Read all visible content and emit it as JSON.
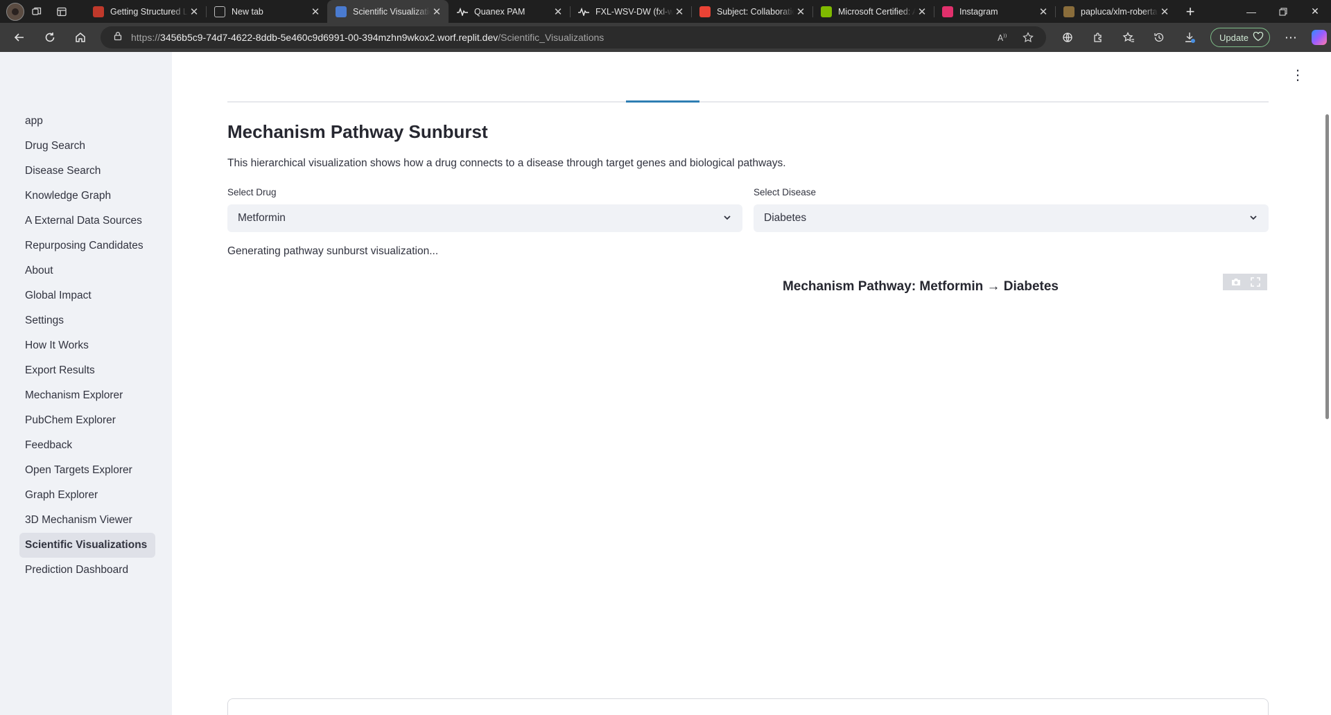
{
  "browser": {
    "tabs": [
      {
        "title": "Getting Structured LLM",
        "favicon": "circle-red-icon",
        "color": "#c0392b"
      },
      {
        "title": "New tab",
        "favicon": "page-icon",
        "color": "#5f6368"
      },
      {
        "title": "Scientific Visualizations",
        "favicon": "chart-icon",
        "color": "#4a7bd0",
        "active": true
      },
      {
        "title": "Quanex PAM",
        "favicon": "pulse-icon",
        "color": "#e3e3e3"
      },
      {
        "title": "FXL-WSV-DW (fxl-wsv-dw)",
        "favicon": "pulse-icon",
        "color": "#e3e3e3"
      },
      {
        "title": "Subject: Collaboration",
        "favicon": "gmail-icon",
        "color": "#ea4335"
      },
      {
        "title": "Microsoft Certified: Azure",
        "favicon": "microsoft-icon",
        "color": "#7fba00"
      },
      {
        "title": "Instagram",
        "favicon": "instagram-icon",
        "color": "#e1306c"
      },
      {
        "title": "papluca/xlm-roberta",
        "favicon": "hf-icon",
        "color": "#8a6d3b"
      }
    ],
    "url_scheme": "https://",
    "url_host": "3456b5c9-74d7-4622-8ddb-5e460c9d6991-00-394mzhn9wkox2.worf.replit.dev",
    "url_path": "/Scientific_Visualizations",
    "update_label": "Update"
  },
  "sidebar": {
    "items": [
      {
        "label": "app"
      },
      {
        "label": "Drug Search"
      },
      {
        "label": "Disease Search"
      },
      {
        "label": "Knowledge Graph"
      },
      {
        "label": "A External Data Sources"
      },
      {
        "label": "Repurposing Candidates"
      },
      {
        "label": "About"
      },
      {
        "label": "Global Impact"
      },
      {
        "label": "Settings"
      },
      {
        "label": "How It Works"
      },
      {
        "label": "Export Results"
      },
      {
        "label": "Mechanism Explorer"
      },
      {
        "label": "PubChem Explorer"
      },
      {
        "label": "Feedback"
      },
      {
        "label": "Open Targets Explorer"
      },
      {
        "label": "Graph Explorer"
      },
      {
        "label": "3D Mechanism Viewer"
      },
      {
        "label": "Scientific Visualizations",
        "active": true
      },
      {
        "label": "Prediction Dashboard"
      }
    ]
  },
  "main": {
    "title": "Mechanism Pathway Sunburst",
    "description": "This hierarchical visualization shows how a drug connects to a disease through target genes and biological pathways.",
    "drug_label": "Select Drug",
    "drug_value": "Metformin",
    "disease_label": "Select Disease",
    "disease_value": "Diabetes",
    "status": "Generating pathway sunburst visualization...",
    "chart_title": "Mechanism Pathway: Metformin → Diabetes"
  }
}
